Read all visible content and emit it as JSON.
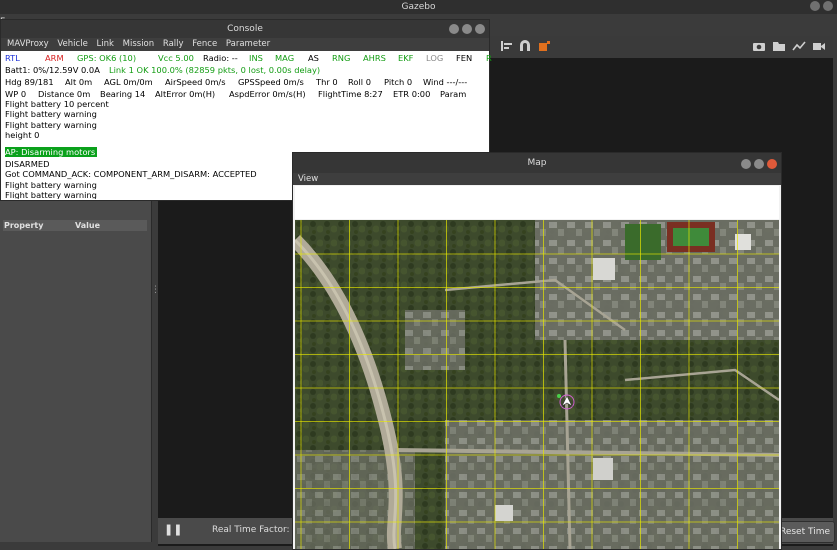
{
  "gazebo": {
    "window_title": "Gazebo",
    "left_panel_letter": "F",
    "property_header": {
      "property": "Property",
      "value": "Value"
    },
    "bottom_bar": {
      "pause_glyph": "❚❚",
      "real_time_factor_label": "Real Time Factor:",
      "reset_button_label": "Reset Time"
    }
  },
  "console": {
    "title": "Console",
    "menu": [
      "MAVProxy",
      "Vehicle",
      "Link",
      "Mission",
      "Rally",
      "Fence",
      "Parameter"
    ],
    "status_row1": [
      {
        "text": "RTL",
        "color": "#1a2fd6"
      },
      {
        "text": "ARM",
        "color": "#d62020"
      },
      {
        "text": "GPS: OK6 (10)",
        "color": "#129c12"
      },
      {
        "text": "Vcc 5.00",
        "color": "#129c12"
      },
      {
        "text": "Radio: --",
        "color": "#000000"
      },
      {
        "text": "INS",
        "color": "#129c12"
      },
      {
        "text": "MAG",
        "color": "#129c12"
      },
      {
        "text": "AS",
        "color": "#000000"
      },
      {
        "text": "RNG",
        "color": "#129c12"
      },
      {
        "text": "AHRS",
        "color": "#129c12"
      },
      {
        "text": "EKF",
        "color": "#129c12"
      },
      {
        "text": "LOG",
        "color": "#888888"
      },
      {
        "text": "FEN",
        "color": "#000000"
      },
      {
        "text": "R",
        "color": "#129c12"
      }
    ],
    "status_row2": [
      {
        "text": "Batt1: 0%/12.59V 0.0A",
        "color": "#000000"
      },
      {
        "text": "Link 1 OK 100.0% (82859 pkts, 0 lost, 0.00s delay)",
        "color": "#129c12"
      }
    ],
    "status_row3": [
      "Hdg 89/181",
      "Alt 0m",
      "AGL 0m/0m",
      "AirSpeed 0m/s",
      "GPSSpeed 0m/s",
      "Thr 0",
      "Roll 0",
      "Pitch 0",
      "Wind ---/---"
    ],
    "status_row4": [
      "WP 0",
      "Distance 0m",
      "Bearing 14",
      "AltError 0m(H)",
      "AspdError 0m/s(H)",
      "FlightTime 8:27",
      "ETR 0:00",
      "Param"
    ],
    "log": [
      "Flight battery 10 percent",
      "Flight battery warning",
      "Flight battery warning",
      "height 0",
      "AP: Disarming motors",
      "DISARMED",
      "Got COMMAND_ACK: COMPONENT_ARM_DISARM: ACCEPTED",
      "Flight battery warning",
      "Flight battery warning"
    ],
    "highlight_color": "#0aa11b"
  },
  "map": {
    "title": "Map",
    "menu": [
      "View"
    ],
    "grid_color": "#e8e800",
    "vehicle_icon": "vehicle-marker-icon"
  }
}
